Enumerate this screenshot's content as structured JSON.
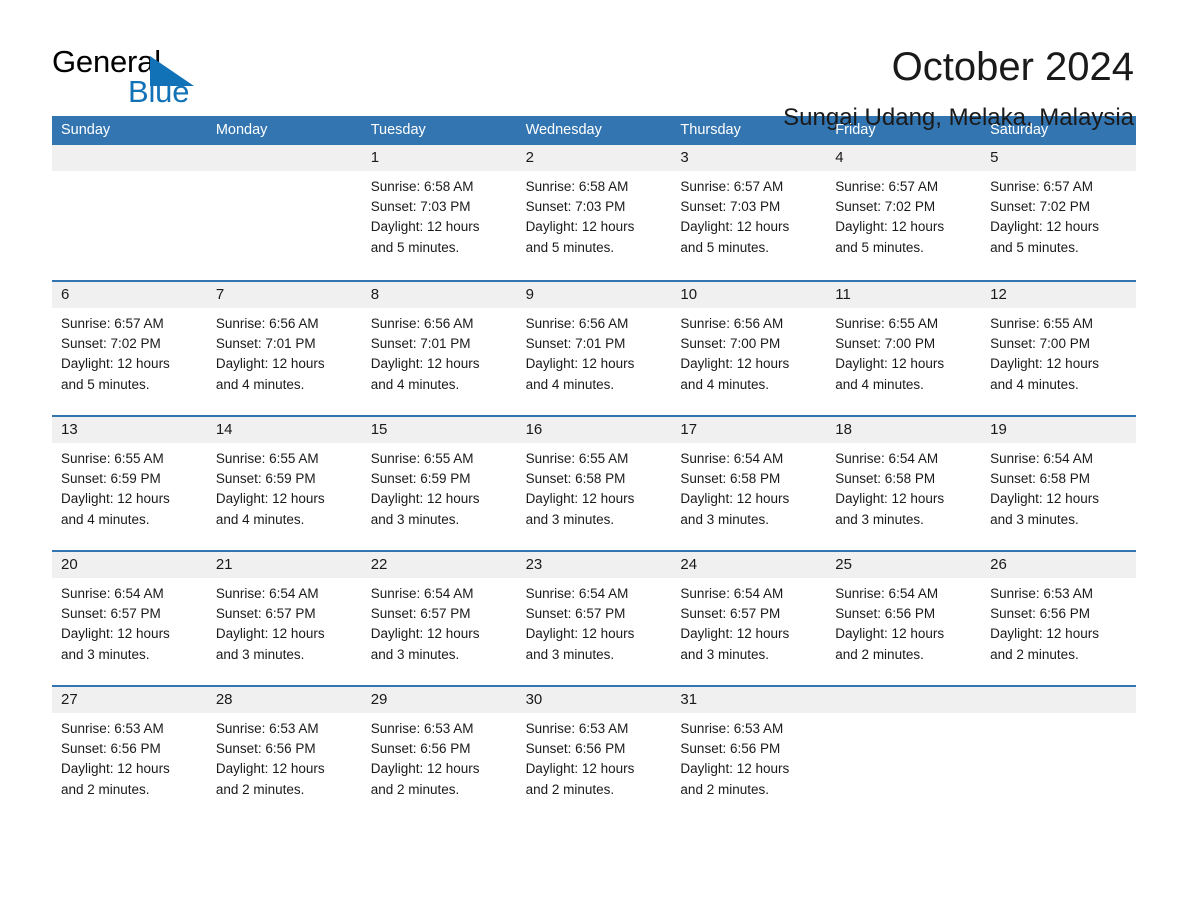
{
  "brand": {
    "name_part1": "General",
    "name_part2": "Blue",
    "triangle_icon": "triangle-icon",
    "accent_color": "#1272b8"
  },
  "header": {
    "month_title": "October 2024",
    "location": "Sungai Udang, Melaka, Malaysia"
  },
  "calendar": {
    "header_color": "#3375b1",
    "weekdays": [
      "Sunday",
      "Monday",
      "Tuesday",
      "Wednesday",
      "Thursday",
      "Friday",
      "Saturday"
    ],
    "weeks": [
      [
        {
          "day": "",
          "lines": []
        },
        {
          "day": "",
          "lines": []
        },
        {
          "day": "1",
          "lines": [
            "Sunrise: 6:58 AM",
            "Sunset: 7:03 PM",
            "Daylight: 12 hours",
            "and 5 minutes."
          ]
        },
        {
          "day": "2",
          "lines": [
            "Sunrise: 6:58 AM",
            "Sunset: 7:03 PM",
            "Daylight: 12 hours",
            "and 5 minutes."
          ]
        },
        {
          "day": "3",
          "lines": [
            "Sunrise: 6:57 AM",
            "Sunset: 7:03 PM",
            "Daylight: 12 hours",
            "and 5 minutes."
          ]
        },
        {
          "day": "4",
          "lines": [
            "Sunrise: 6:57 AM",
            "Sunset: 7:02 PM",
            "Daylight: 12 hours",
            "and 5 minutes."
          ]
        },
        {
          "day": "5",
          "lines": [
            "Sunrise: 6:57 AM",
            "Sunset: 7:02 PM",
            "Daylight: 12 hours",
            "and 5 minutes."
          ]
        }
      ],
      [
        {
          "day": "6",
          "lines": [
            "Sunrise: 6:57 AM",
            "Sunset: 7:02 PM",
            "Daylight: 12 hours",
            "and 5 minutes."
          ]
        },
        {
          "day": "7",
          "lines": [
            "Sunrise: 6:56 AM",
            "Sunset: 7:01 PM",
            "Daylight: 12 hours",
            "and 4 minutes."
          ]
        },
        {
          "day": "8",
          "lines": [
            "Sunrise: 6:56 AM",
            "Sunset: 7:01 PM",
            "Daylight: 12 hours",
            "and 4 minutes."
          ]
        },
        {
          "day": "9",
          "lines": [
            "Sunrise: 6:56 AM",
            "Sunset: 7:01 PM",
            "Daylight: 12 hours",
            "and 4 minutes."
          ]
        },
        {
          "day": "10",
          "lines": [
            "Sunrise: 6:56 AM",
            "Sunset: 7:00 PM",
            "Daylight: 12 hours",
            "and 4 minutes."
          ]
        },
        {
          "day": "11",
          "lines": [
            "Sunrise: 6:55 AM",
            "Sunset: 7:00 PM",
            "Daylight: 12 hours",
            "and 4 minutes."
          ]
        },
        {
          "day": "12",
          "lines": [
            "Sunrise: 6:55 AM",
            "Sunset: 7:00 PM",
            "Daylight: 12 hours",
            "and 4 minutes."
          ]
        }
      ],
      [
        {
          "day": "13",
          "lines": [
            "Sunrise: 6:55 AM",
            "Sunset: 6:59 PM",
            "Daylight: 12 hours",
            "and 4 minutes."
          ]
        },
        {
          "day": "14",
          "lines": [
            "Sunrise: 6:55 AM",
            "Sunset: 6:59 PM",
            "Daylight: 12 hours",
            "and 4 minutes."
          ]
        },
        {
          "day": "15",
          "lines": [
            "Sunrise: 6:55 AM",
            "Sunset: 6:59 PM",
            "Daylight: 12 hours",
            "and 3 minutes."
          ]
        },
        {
          "day": "16",
          "lines": [
            "Sunrise: 6:55 AM",
            "Sunset: 6:58 PM",
            "Daylight: 12 hours",
            "and 3 minutes."
          ]
        },
        {
          "day": "17",
          "lines": [
            "Sunrise: 6:54 AM",
            "Sunset: 6:58 PM",
            "Daylight: 12 hours",
            "and 3 minutes."
          ]
        },
        {
          "day": "18",
          "lines": [
            "Sunrise: 6:54 AM",
            "Sunset: 6:58 PM",
            "Daylight: 12 hours",
            "and 3 minutes."
          ]
        },
        {
          "day": "19",
          "lines": [
            "Sunrise: 6:54 AM",
            "Sunset: 6:58 PM",
            "Daylight: 12 hours",
            "and 3 minutes."
          ]
        }
      ],
      [
        {
          "day": "20",
          "lines": [
            "Sunrise: 6:54 AM",
            "Sunset: 6:57 PM",
            "Daylight: 12 hours",
            "and 3 minutes."
          ]
        },
        {
          "day": "21",
          "lines": [
            "Sunrise: 6:54 AM",
            "Sunset: 6:57 PM",
            "Daylight: 12 hours",
            "and 3 minutes."
          ]
        },
        {
          "day": "22",
          "lines": [
            "Sunrise: 6:54 AM",
            "Sunset: 6:57 PM",
            "Daylight: 12 hours",
            "and 3 minutes."
          ]
        },
        {
          "day": "23",
          "lines": [
            "Sunrise: 6:54 AM",
            "Sunset: 6:57 PM",
            "Daylight: 12 hours",
            "and 3 minutes."
          ]
        },
        {
          "day": "24",
          "lines": [
            "Sunrise: 6:54 AM",
            "Sunset: 6:57 PM",
            "Daylight: 12 hours",
            "and 3 minutes."
          ]
        },
        {
          "day": "25",
          "lines": [
            "Sunrise: 6:54 AM",
            "Sunset: 6:56 PM",
            "Daylight: 12 hours",
            "and 2 minutes."
          ]
        },
        {
          "day": "26",
          "lines": [
            "Sunrise: 6:53 AM",
            "Sunset: 6:56 PM",
            "Daylight: 12 hours",
            "and 2 minutes."
          ]
        }
      ],
      [
        {
          "day": "27",
          "lines": [
            "Sunrise: 6:53 AM",
            "Sunset: 6:56 PM",
            "Daylight: 12 hours",
            "and 2 minutes."
          ]
        },
        {
          "day": "28",
          "lines": [
            "Sunrise: 6:53 AM",
            "Sunset: 6:56 PM",
            "Daylight: 12 hours",
            "and 2 minutes."
          ]
        },
        {
          "day": "29",
          "lines": [
            "Sunrise: 6:53 AM",
            "Sunset: 6:56 PM",
            "Daylight: 12 hours",
            "and 2 minutes."
          ]
        },
        {
          "day": "30",
          "lines": [
            "Sunrise: 6:53 AM",
            "Sunset: 6:56 PM",
            "Daylight: 12 hours",
            "and 2 minutes."
          ]
        },
        {
          "day": "31",
          "lines": [
            "Sunrise: 6:53 AM",
            "Sunset: 6:56 PM",
            "Daylight: 12 hours",
            "and 2 minutes."
          ]
        },
        {
          "day": "",
          "lines": []
        },
        {
          "day": "",
          "lines": []
        }
      ]
    ]
  }
}
